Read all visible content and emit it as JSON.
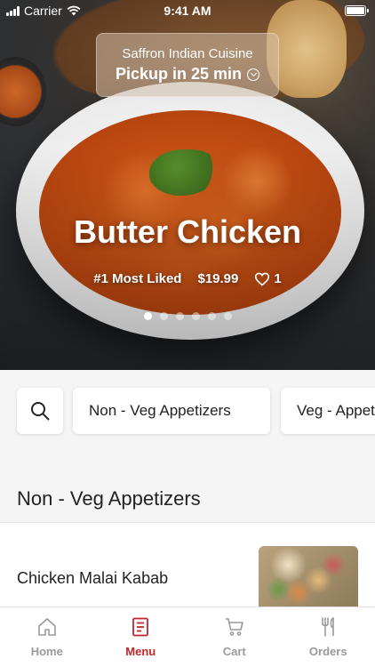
{
  "status_bar": {
    "carrier": "Carrier",
    "time": "9:41 AM"
  },
  "restaurant": {
    "name": "Saffron Indian Cuisine",
    "pickup": "Pickup in 25 min"
  },
  "featured": {
    "title": "Butter Chicken",
    "badge": "#1 Most Liked",
    "price": "$19.99",
    "likes": "1",
    "carousel_pages": 6,
    "active_page": 1
  },
  "categories": [
    "Non - Veg Appetizers",
    "Veg - Appetizers"
  ],
  "section": {
    "title": "Non - Veg Appetizers"
  },
  "menu_items": [
    {
      "name": "Chicken Malai Kabab"
    }
  ],
  "tabs": [
    {
      "label": "Home",
      "icon": "home-icon",
      "active": false
    },
    {
      "label": "Menu",
      "icon": "menu-icon",
      "active": true
    },
    {
      "label": "Cart",
      "icon": "cart-icon",
      "active": false
    },
    {
      "label": "Orders",
      "icon": "orders-icon",
      "active": false
    }
  ],
  "colors": {
    "accent": "#c0252b",
    "inactive": "#9a9a9a"
  }
}
